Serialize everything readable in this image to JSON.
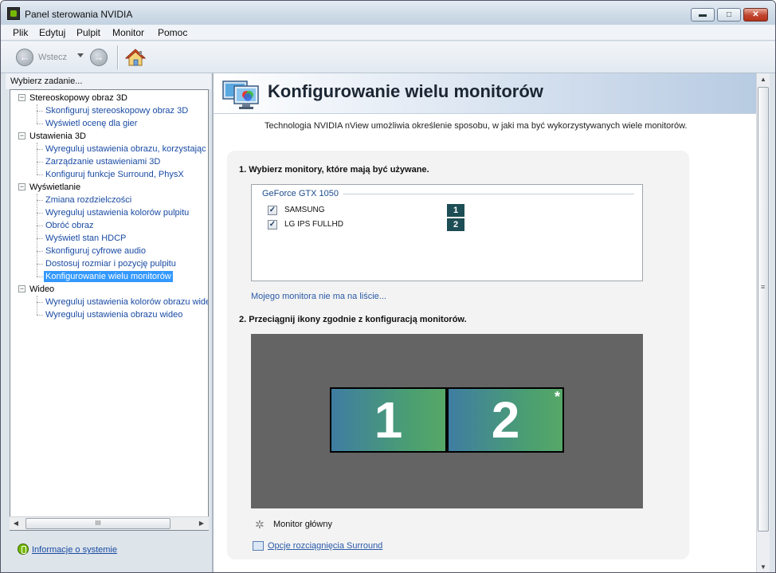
{
  "window": {
    "title": "Panel sterowania NVIDIA"
  },
  "controls": {
    "minimize": "▬",
    "maximize": "□",
    "close": "✕"
  },
  "menu": [
    {
      "label": "Plik"
    },
    {
      "label": "Edytuj"
    },
    {
      "label": "Pulpit"
    },
    {
      "label": "Monitor"
    },
    {
      "label": "Pomoc"
    }
  ],
  "toolbar": {
    "back_label": "Wstecz",
    "back_icon": "back-arrow-icon",
    "forward_icon": "forward-arrow-icon",
    "home_icon": "home-icon"
  },
  "sidebar": {
    "header": "Wybierz zadanie...",
    "tree": [
      {
        "category": "Stereoskopowy obraz 3D",
        "items": [
          "Skonfiguruj stereoskopowy obraz 3D",
          "Wyświetl ocenę dla gier"
        ]
      },
      {
        "category": "Ustawienia 3D",
        "items": [
          "Wyreguluj ustawienia obrazu, korzystając z",
          "Zarządzanie ustawieniami 3D",
          "Konfiguruj funkcje Surround, PhysX"
        ]
      },
      {
        "category": "Wyświetlanie",
        "items": [
          "Zmiana rozdzielczości",
          "Wyreguluj ustawienia kolorów pulpitu",
          "Obróć obraz",
          "Wyświetl stan HDCP",
          "Skonfiguruj cyfrowe audio",
          "Dostosuj rozmiar i pozycję pulpitu",
          "Konfigurowanie wielu monitorów"
        ]
      },
      {
        "category": "Wideo",
        "items": [
          "Wyreguluj ustawienia kolorów obrazu wideo",
          "Wyreguluj ustawienia obrazu wideo"
        ]
      }
    ],
    "selected_item": "Konfigurowanie wielu monitorów",
    "hscroll_grip": "III",
    "system_info_link": "Informacje o systemie"
  },
  "main": {
    "title": "Konfigurowanie wielu monitorów",
    "intro": "Technologia NVIDIA nView umożliwia określenie sposobu, w jaki ma być wykorzystywanych wiele monitorów.",
    "step1_title": "1. Wybierz monitory, które mają być używane.",
    "gpu_name": "GeForce GTX 1050",
    "monitors": [
      {
        "name": "SAMSUNG",
        "number": "1",
        "checked": true,
        "check_mark": "✓"
      },
      {
        "name": "LG IPS FULLHD",
        "number": "2",
        "checked": true,
        "check_mark": "✓"
      }
    ],
    "not_listed_link": "Mojego monitora nie ma na liście...",
    "step2_title": "2. Przeciągnij ikony zgodnie z konfiguracją monitorów.",
    "arrangement": [
      {
        "number": "1",
        "primary": false
      },
      {
        "number": "2",
        "primary": true
      }
    ],
    "primary_marker": "*",
    "primary_label": "Monitor główny",
    "surround_link": "Opcje rozciągnięcia Surround"
  },
  "colors": {
    "accent_link": "#1a4ba3",
    "selection": "#3399ff",
    "monitor_badge": "#1d4d55",
    "arrange_bg": "#646464"
  }
}
